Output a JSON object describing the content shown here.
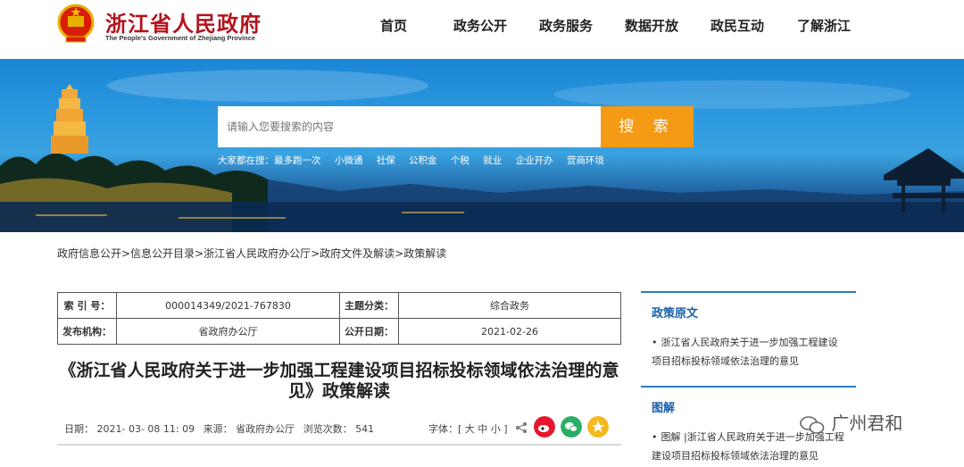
{
  "header": {
    "title": "浙江省人民政府",
    "subtitle": "The People's Government of Zhejiang Province",
    "nav": [
      "首页",
      "政务公开",
      "政务服务",
      "数据开放",
      "政民互动",
      "了解浙江"
    ]
  },
  "search": {
    "placeholder": "请输入您要搜索的内容",
    "button": "搜 索",
    "hot_label": "大家都在搜：最多跑一次",
    "hot_links": [
      "小微通",
      "社保",
      "公积金",
      "个税",
      "就业",
      "企业开办",
      "营商环境"
    ]
  },
  "breadcrumb": "政府信息公开>信息公开目录>浙江省人民政府办公厅>政府文件及解读>政策解读",
  "info": {
    "index_label": "索 引 号：",
    "index_value": "000014349/2021-767830",
    "category_label": "主题分类：",
    "category_value": "综合政务",
    "issuer_label": "发布机构：",
    "issuer_value": "省政府办公厅",
    "date_label": "公开日期：",
    "date_value": "2021-02-26"
  },
  "article": {
    "title": "《浙江省人民政府关于进一步加强工程建设项目招标投标领域依法治理的意见》政策解读",
    "meta_date": "日期： 2021- 03- 08 11: 09",
    "meta_source": "来源： 省政府办公厅",
    "meta_views": "浏览次数： 541",
    "font_size": "字体：[ 大 中 小 ]"
  },
  "sidebar": {
    "policy_head": "政策原文",
    "policy_item": "浙江省人民政府关于进一步加强工程建设项目招标投标领域依法治理的意见",
    "graphic_head": "图解",
    "graphic_item": "图解 |浙江省人民政府关于进一步加强工程建设项目招标投标领域依法治理的意见"
  },
  "watermark": "广州君和",
  "colors": {
    "brand_red": "#b3141e",
    "search_orange": "#f59a14",
    "sidebar_blue": "#1a5fa8",
    "weibo_red": "#e6162d",
    "wechat_green": "#2aae67",
    "star_yellow": "#f5b820"
  }
}
